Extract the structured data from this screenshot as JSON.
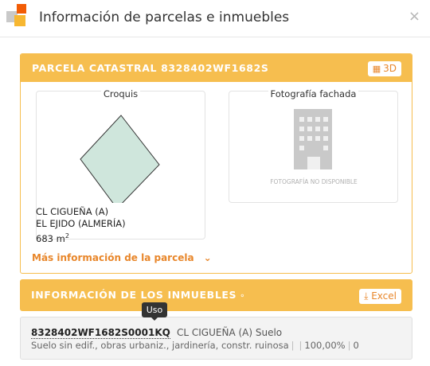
{
  "dialog": {
    "title": "Información de parcelas e inmuebles",
    "close_glyph": "×"
  },
  "parcela": {
    "title": "PARCELA CATASTRAL 8328402WF1682S",
    "btn_3d": "3D",
    "croquis_legend": "Croquis",
    "foto_legend": "Fotografía fachada",
    "foto_unavailable": "FOTOGRAFÍA NO DISPONIBLE",
    "address_line1": "CL CIGUEÑA (A)",
    "address_line2": "EL EJIDO (ALMERÍA)",
    "area_value": "683 m",
    "area_unit_sup": "2",
    "more_info": "Más información de la parcela"
  },
  "inmuebles": {
    "title": "INFORMACIÓN DE LOS INMUEBLES",
    "excel_button": "Excel",
    "items": [
      {
        "reference": "8328402WF1682S0001KQ",
        "address": "CL CIGUEÑA (A) Suelo",
        "use": "Suelo sin edif., obras urbaniz., jardinería, constr. ruinosa",
        "blank": "",
        "participation": "100,00%",
        "year": "0"
      }
    ],
    "tooltip": "Uso"
  },
  "colors": {
    "accent": "#f6be4f",
    "accent_text": "#e8862a",
    "parcel_fill": "#cfe6dc"
  },
  "icons": {
    "logo": "catastro-logo",
    "close": "close-icon",
    "3d": "cubes-icon",
    "excel": "download-icon",
    "more": "chevron-down-icon",
    "building": "building-icon",
    "comment": "comment-icon"
  }
}
